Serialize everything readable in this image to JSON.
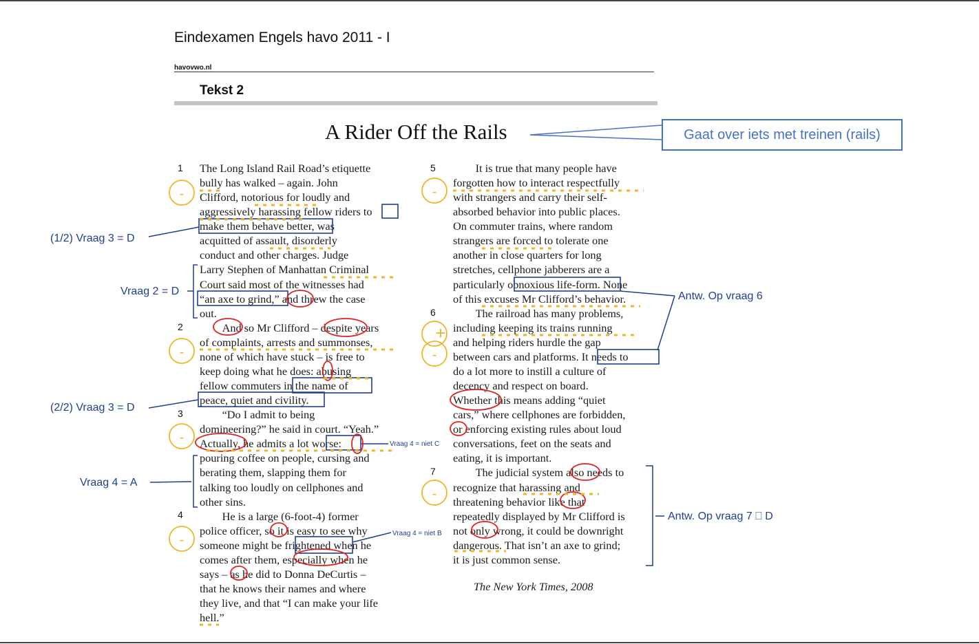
{
  "header": {
    "exam_title": "Eindexamen Engels havo 2011 - I",
    "site": "havovwo.nl",
    "section": "Tekst 2"
  },
  "article": {
    "title": "A Rider Off the Rails",
    "source": "The New York Times, 2008",
    "left_column": [
      "The Long Island Rail Road’s etiquette",
      "bully has walked – again. John",
      "Clifford, notorious for loudly and",
      "aggressively harassing fellow riders to",
      "make them behave better, was",
      "acquitted of assault, disorderly",
      "conduct and other charges. Judge",
      "Larry Stephen of Manhattan Criminal",
      "Court said most of the witnesses had",
      "“an axe to grind,” and threw the case",
      "out.",
      "  And so Mr Clifford – despite years",
      "of complaints, arrests and summonses,",
      "none of which have stuck – is free to",
      "keep doing what he does: abusing",
      "fellow commuters in the name of",
      "peace, quiet and civility.",
      "  “Do I admit to being",
      "domineering?” he said in court. “Yeah.”",
      "Actually, he admits a lot worse:",
      "pouring coffee on people, cursing and",
      "berating them, slapping them for",
      "talking too loudly on cellphones and",
      "other sins.",
      "  He is a large (6-foot-4) former",
      "police officer, so it is easy to see why",
      "someone might be frightened when he",
      "comes after them, especially when he",
      "says – as he did to Donna DeCurtis –",
      "that he knows their names and where",
      "they live, and that “I can make your life",
      "hell.”"
    ],
    "right_column": [
      "  It is true that many people have",
      "forgotten how to interact respectfully",
      "with strangers and carry their self-",
      "absorbed behavior into public places.",
      "On commuter trains, where random",
      "strangers are forced to tolerate one",
      "another in close quarters for long",
      "stretches, cellphone jabberers are a",
      "particularly obnoxious life-form. None",
      "of this excuses Mr Clifford’s behavior.",
      "  The railroad has many problems,",
      "including keeping its trains running",
      "and helping riders hurdle the gap",
      "between cars and platforms. It needs to",
      "do a lot more to instill a culture of",
      "decency and respect on board.",
      "Whether this means adding “quiet",
      "cars,” where cellphones are forbidden,",
      "or enforcing existing rules about loud",
      "conversations, feet on the seats and",
      "eating, it is important.",
      "  The judicial system also needs to",
      "recognize that harassing and",
      "threatening behavior like that",
      "repeatedly displayed by Mr Clifford is",
      "not only wrong, it could be downright",
      "dangerous. That isn’t an axe to grind;",
      "it is just common sense."
    ],
    "paragraph_numbers": [
      "1",
      "2",
      "3",
      "4",
      "5",
      "6",
      "7"
    ]
  },
  "annotations": {
    "callout": "Gaat over iets met treinen (rails)",
    "notes": [
      "(1/2) Vraag 3 = D",
      "Vraag 2 = D",
      "(2/2) Vraag 3 = D",
      "Vraag 4 = A",
      "Antw. Op vraag 6",
      "Antw. Op vraag 7 ⎕ D"
    ],
    "small_notes": [
      "Vraag 4 = niet C",
      "Vraag 4 = niet B"
    ],
    "sentiment_marks": [
      "-",
      "-",
      "-",
      "-",
      "-",
      "+",
      "-",
      "-"
    ],
    "colors": {
      "box": "#1f3f8f",
      "circle": "#e02020",
      "marker": "#f0b429",
      "callout": "#4472c4"
    }
  }
}
